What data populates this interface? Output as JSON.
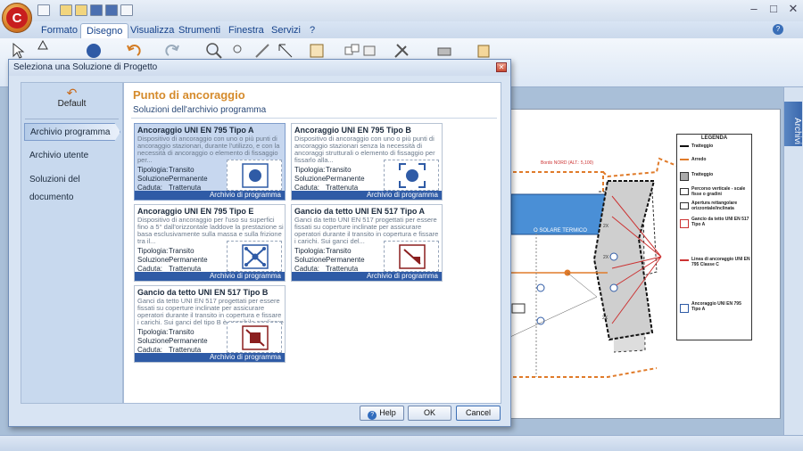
{
  "ribbon": {
    "tabs": [
      "Formato",
      "Disegno",
      "Visualizza",
      "Strumenti",
      "Finestra",
      "Servizi",
      "?"
    ],
    "active_tab": "Disegno"
  },
  "sidebar": {
    "tab_label": "Archivi"
  },
  "drawing": {
    "building_label": "O SOLARE TERMICO",
    "roof_note": "Bordo NORD (ALT.: 5,100)",
    "dim_labels": [
      "2X",
      "2X",
      "2X"
    ],
    "legend": {
      "title": "LEGENDA",
      "items": [
        "Tratteggio",
        "Arredo",
        "Tratteggio",
        "Percorso verticale - scale fisse o gradini",
        "Apertura rettangolare orizzontale/inclinata",
        "Gancio da tetto UNI EN 517 Tipo A",
        "Linea di ancoraggio UNI EN 795 Classe C",
        "Ancoraggio UNI EN 795 Tipo A"
      ]
    }
  },
  "dialog": {
    "title": "Seleziona una Soluzione di Progetto",
    "nav": {
      "default_label": "Default",
      "items": [
        "Archivio programma",
        "Archivio utente",
        "Soluzioni del documento"
      ],
      "selected": 0
    },
    "heading": "Punto di ancoraggio",
    "subheading": "Soluzioni dell'archivio programma",
    "prop_labels": [
      "Tipologia:",
      "Soluzione:",
      "Caduta:"
    ],
    "cards": [
      {
        "title": "Ancoraggio UNI EN 795 Tipo A",
        "description": "Dispositivo di ancoraggio con uno o più punti di ancoraggio stazionari, durante l'utilizzo, e con la necessità di ancoraggio o elemento di fissaggio per...",
        "tipologia": "Transito",
        "soluzione": "Permanente",
        "caduta": "Trattenuta",
        "footer": "Archivio di programma",
        "icon": "anchor-point-icon"
      },
      {
        "title": "Ancoraggio UNI EN 795 Tipo B",
        "description": "Dispositivo di ancoraggio con uno o più punti di ancoraggio stazionari senza la necessità di ancoraggi strutturali o elemento di fissaggio per fissarlo alla...",
        "tipologia": "Transito",
        "soluzione": "Permanente",
        "caduta": "Trattenuta",
        "footer": "Archivio di programma",
        "icon": "anchor-point-b-icon"
      },
      {
        "title": "Ancoraggio UNI EN 795 Tipo E",
        "description": "Dispositivo di ancoraggio per l'uso su superfici fino a 5° dall'orizzontale laddove la prestazione si basa esclusivamente sulla massa e sulla frizione tra il...",
        "tipologia": "Transito",
        "soluzione": "Permanente",
        "caduta": "Trattenuta",
        "footer": "Archivio di programma",
        "icon": "deadweight-anchor-icon"
      },
      {
        "title": "Gancio da tetto UNI EN 517 Tipo A",
        "description": "Ganci da tetto UNI EN 517 progettati per essere fissati su coperture inclinate per assicurare operatori durante il transito in copertura e fissare i carichi. Sui ganci del...",
        "tipologia": "Transito",
        "soluzione": "Permanente",
        "caduta": "Trattenuta",
        "footer": "Archivio di programma",
        "icon": "roof-hook-a-icon"
      },
      {
        "title": "Gancio da tetto UNI EN 517 Tipo B",
        "description": "Ganci da tetto UNI EN 517 progettati per essere fissati su coperture inclinate per assicurare operatori durante il transito in copertura e fissare i carichi. Sui ganci del tipo B è possibile applicare un...",
        "tipologia": "Transito",
        "soluzione": "Permanente",
        "caduta": "Trattenuta",
        "footer": "Archivio di programma",
        "icon": "roof-hook-b-icon"
      }
    ],
    "buttons": {
      "help": "Help",
      "ok": "OK",
      "cancel": "Cancel"
    }
  }
}
